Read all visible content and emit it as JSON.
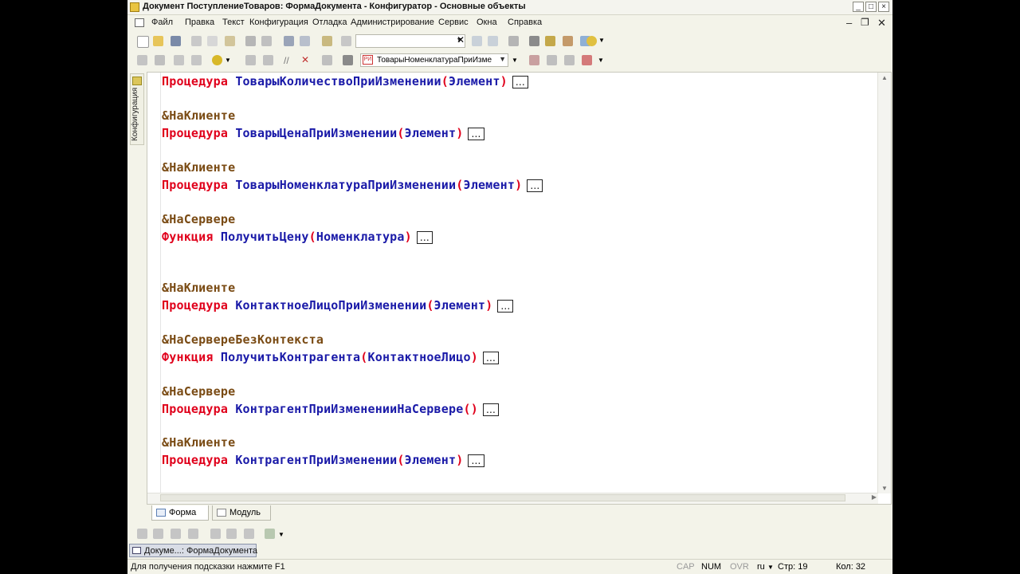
{
  "window": {
    "title": "Документ ПоступлениеТоваров: ФормаДокумента - Конфигуратор - Основные объекты"
  },
  "menu": {
    "items": [
      "Файл",
      "Правка",
      "Текст",
      "Конфигурация",
      "Отладка",
      "Администрирование",
      "Сервис",
      "Окна",
      "Справка"
    ]
  },
  "toolbar2": {
    "combo_value": "ТоварыНоменклатураПриИзме",
    "combo_prefix": "РИ"
  },
  "left_panel": {
    "label": "Конфигурация"
  },
  "code": {
    "collapsed_marker": "...",
    "lines": [
      {
        "type": "proc",
        "kw": "Процедура",
        "name": "ТоварыКоличествоПриИзменении",
        "params": "Элемент"
      },
      {
        "type": "dir",
        "text": "&НаКлиенте"
      },
      {
        "type": "proc",
        "kw": "Процедура",
        "name": "ТоварыЦенаПриИзменении",
        "params": "Элемент"
      },
      {
        "type": "dir",
        "text": "&НаКлиенте"
      },
      {
        "type": "proc",
        "kw": "Процедура",
        "name": "ТоварыНоменклатураПриИзменении",
        "params": "Элемент"
      },
      {
        "type": "dir",
        "text": "&НаСервере"
      },
      {
        "type": "proc",
        "kw": "Функция",
        "name": "ПолучитьЦену",
        "params": "Номенклатура"
      },
      {
        "type": "dir",
        "text": "&НаКлиенте"
      },
      {
        "type": "proc",
        "kw": "Процедура",
        "name": "КонтактноеЛицоПриИзменении",
        "params": "Элемент"
      },
      {
        "type": "dir",
        "text": "&НаСервереБезКонтекста"
      },
      {
        "type": "proc",
        "kw": "Функция",
        "name": "ПолучитьКонтрагента",
        "params": "КонтактноеЛицо"
      },
      {
        "type": "dir",
        "text": "&НаСервере"
      },
      {
        "type": "proc",
        "kw": "Процедура",
        "name": "КонтрагентПриИзмененииНаСервере",
        "params": ""
      },
      {
        "type": "dir",
        "text": "&НаКлиенте"
      },
      {
        "type": "proc",
        "kw": "Процедура",
        "name": "КонтрагентПриИзменении",
        "params": "Элемент"
      }
    ]
  },
  "tabs": [
    {
      "label": "Форма",
      "active": true
    },
    {
      "label": "Модуль",
      "active": false
    }
  ],
  "taskbar": {
    "item_label": "Докуме...: ФормаДокумента"
  },
  "status": {
    "hint": "Для получения подсказки нажмите F1",
    "cap": "CAP",
    "num": "NUM",
    "ovr": "OVR",
    "lang": "ru",
    "line": "Стр: 19",
    "col": "Кол: 32"
  }
}
